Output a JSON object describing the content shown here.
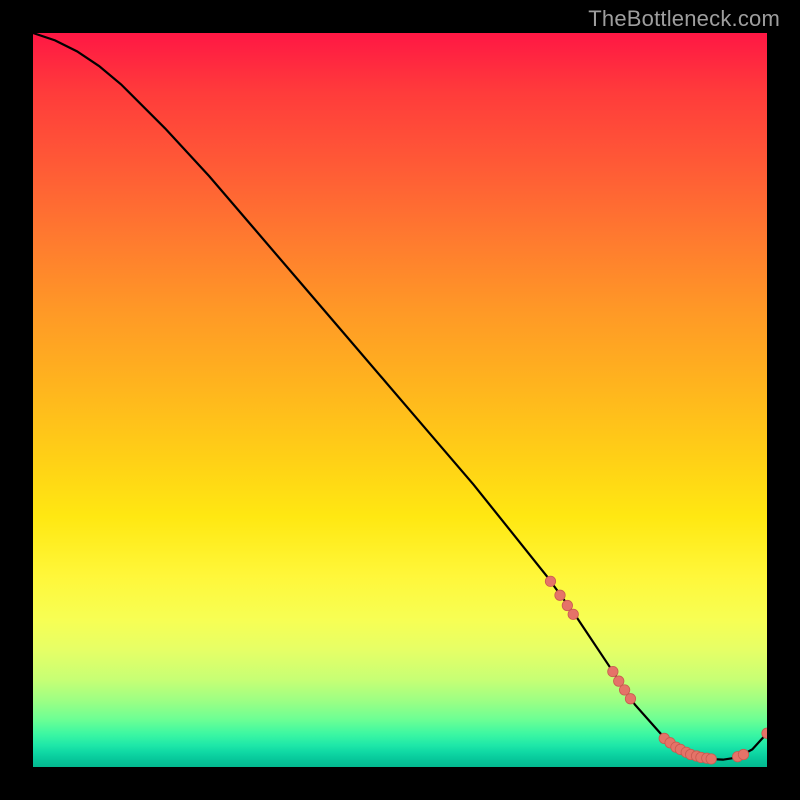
{
  "watermark": "TheBottleneck.com",
  "colors": {
    "background": "#000000",
    "curve": "#000000",
    "marker_fill": "#e57368",
    "marker_stroke": "#c95b50"
  },
  "chart_data": {
    "type": "line",
    "title": "",
    "xlabel": "",
    "ylabel": "",
    "xlim": [
      0,
      100
    ],
    "ylim": [
      0,
      100
    ],
    "grid": false,
    "legend": false,
    "series": [
      {
        "name": "bottleneck-curve",
        "x": [
          0,
          3,
          6,
          9,
          12,
          18,
          24,
          30,
          36,
          42,
          48,
          54,
          60,
          66,
          70,
          74,
          78,
          82,
          86,
          88,
          90,
          92,
          94,
          96,
          98,
          100
        ],
        "y": [
          100,
          99,
          97.5,
          95.5,
          93,
          87,
          80.5,
          73.5,
          66.5,
          59.5,
          52.5,
          45.5,
          38.5,
          31,
          26,
          20.5,
          14.5,
          8.5,
          4,
          2.5,
          1.6,
          1.1,
          1,
          1.3,
          2.4,
          4.6
        ]
      }
    ],
    "markers": [
      {
        "x": 70.5,
        "y": 25.3,
        "r": 5.2
      },
      {
        "x": 71.8,
        "y": 23.4,
        "r": 5.2
      },
      {
        "x": 72.8,
        "y": 22.0,
        "r": 5.2
      },
      {
        "x": 73.6,
        "y": 20.8,
        "r": 5.2
      },
      {
        "x": 79.0,
        "y": 13.0,
        "r": 5.2
      },
      {
        "x": 79.8,
        "y": 11.7,
        "r": 5.2
      },
      {
        "x": 80.6,
        "y": 10.5,
        "r": 5.2
      },
      {
        "x": 81.4,
        "y": 9.3,
        "r": 5.2
      },
      {
        "x": 86.0,
        "y": 3.9,
        "r": 5.2
      },
      {
        "x": 86.8,
        "y": 3.3,
        "r": 5.2
      },
      {
        "x": 87.6,
        "y": 2.7,
        "r": 5.2
      },
      {
        "x": 88.2,
        "y": 2.4,
        "r": 5.2
      },
      {
        "x": 89.0,
        "y": 2.0,
        "r": 5.2
      },
      {
        "x": 89.6,
        "y": 1.7,
        "r": 5.2
      },
      {
        "x": 90.4,
        "y": 1.5,
        "r": 5.2
      },
      {
        "x": 91.0,
        "y": 1.3,
        "r": 5.2
      },
      {
        "x": 91.8,
        "y": 1.2,
        "r": 5.2
      },
      {
        "x": 92.4,
        "y": 1.1,
        "r": 5.2
      },
      {
        "x": 96.0,
        "y": 1.4,
        "r": 5.2
      },
      {
        "x": 96.8,
        "y": 1.7,
        "r": 5.2
      },
      {
        "x": 100.0,
        "y": 4.6,
        "r": 5.2
      }
    ]
  }
}
